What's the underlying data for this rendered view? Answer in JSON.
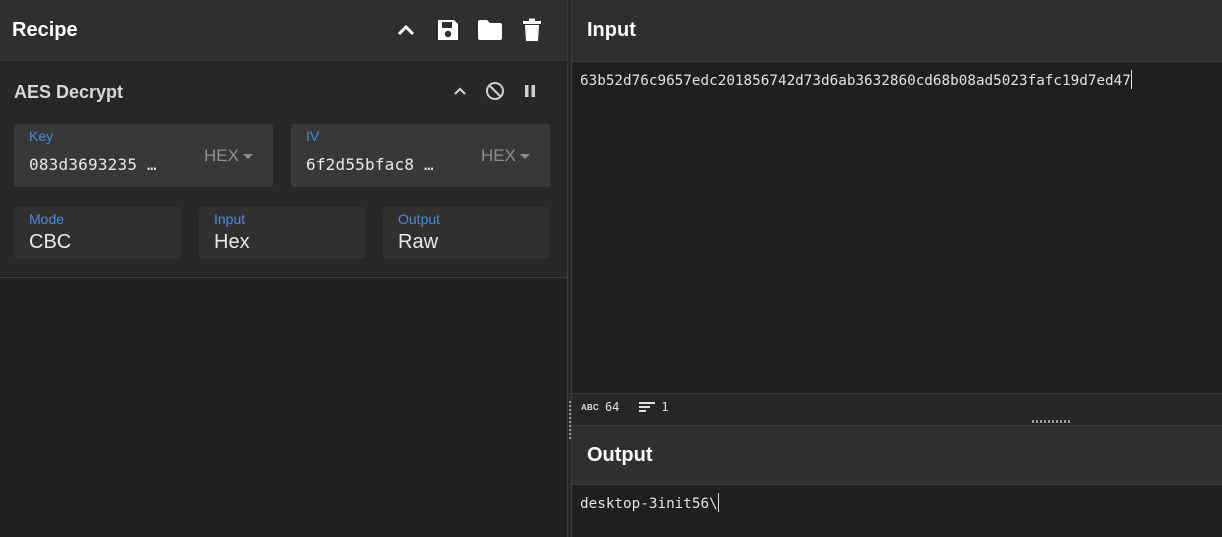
{
  "recipe": {
    "title": "Recipe",
    "icons": [
      "chevron-up-icon",
      "save-icon",
      "folder-icon",
      "trash-icon"
    ]
  },
  "operation": {
    "name": "AES Decrypt",
    "key": {
      "label": "Key",
      "value": "083d3693235 …",
      "encoding": "HEX"
    },
    "iv": {
      "label": "IV",
      "value": "6f2d55bfac8 …",
      "encoding": "HEX"
    },
    "mode": {
      "label": "Mode",
      "value": "CBC"
    },
    "input": {
      "label": "Input",
      "value": "Hex"
    },
    "output": {
      "label": "Output",
      "value": "Raw"
    }
  },
  "input_panel": {
    "title": "Input",
    "text": "63b52d76c9657edc201856742d73d6ab3632860cd68b08ad5023fafc19d7ed47",
    "status": {
      "length": "64",
      "lines": "1"
    }
  },
  "output_panel": {
    "title": "Output",
    "text": "desktop-3init56\\"
  },
  "colors": {
    "accent_label": "#3d8ee6",
    "header_bg": "#2f2f2f",
    "panel_bg": "#202020"
  }
}
